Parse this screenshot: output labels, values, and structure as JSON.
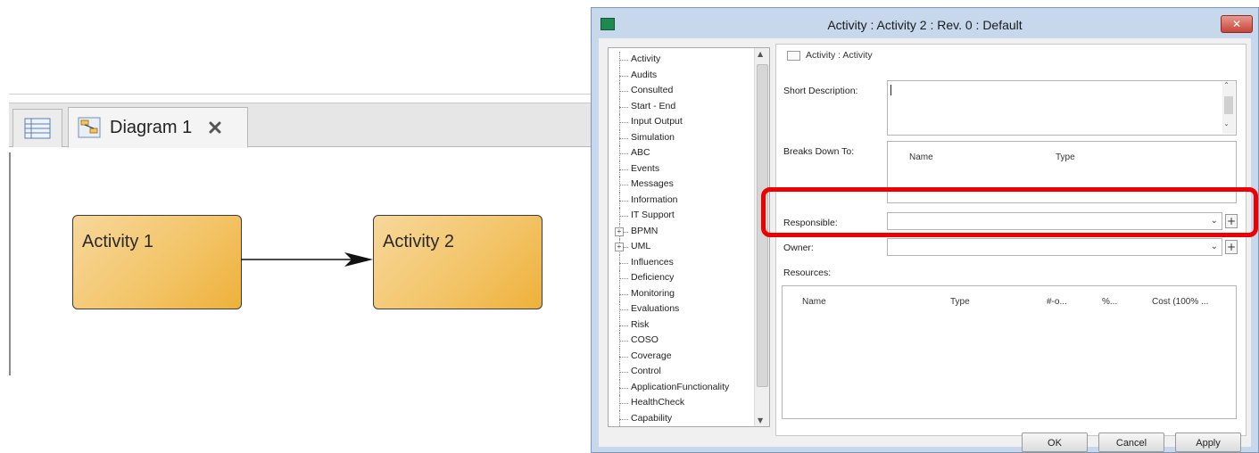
{
  "editor": {
    "tab_label": "Diagram 1",
    "activities": [
      "Activity 1",
      "Activity 2"
    ]
  },
  "dialog": {
    "title": "Activity : Activity 2 : Rev. 0  : Default",
    "close_label": "✕",
    "tree_items": [
      {
        "label": "Activity",
        "expandable": false
      },
      {
        "label": "Audits",
        "expandable": false
      },
      {
        "label": "Consulted",
        "expandable": false
      },
      {
        "label": "Start - End",
        "expandable": false
      },
      {
        "label": "Input Output",
        "expandable": false
      },
      {
        "label": "Simulation",
        "expandable": false
      },
      {
        "label": "ABC",
        "expandable": false
      },
      {
        "label": "Events",
        "expandable": false
      },
      {
        "label": "Messages",
        "expandable": false
      },
      {
        "label": "Information",
        "expandable": false
      },
      {
        "label": "IT Support",
        "expandable": false
      },
      {
        "label": "BPMN",
        "expandable": true
      },
      {
        "label": "UML",
        "expandable": true
      },
      {
        "label": "Influences",
        "expandable": false
      },
      {
        "label": "Deficiency",
        "expandable": false
      },
      {
        "label": "Monitoring",
        "expandable": false
      },
      {
        "label": "Evaluations",
        "expandable": false
      },
      {
        "label": "Risk",
        "expandable": false
      },
      {
        "label": "COSO",
        "expandable": false
      },
      {
        "label": "Coverage",
        "expandable": false
      },
      {
        "label": "Control",
        "expandable": false
      },
      {
        "label": "ApplicationFunctionality",
        "expandable": false
      },
      {
        "label": "HealthCheck",
        "expandable": false
      },
      {
        "label": "Capability",
        "expandable": false
      }
    ],
    "form": {
      "crumb": "Activity : Activity",
      "short_description_label": "Short Description:",
      "short_description_value": "",
      "breaks_down_label": "Breaks Down To:",
      "breaks_down_columns": [
        "Name",
        "Type"
      ],
      "responsible_label": "Responsible:",
      "responsible_value": "",
      "owner_label": "Owner:",
      "owner_value": "",
      "resources_label": "Resources:",
      "resources_columns": [
        "Name",
        "Type",
        "#-o...",
        "%...",
        "Cost (100% ..."
      ]
    },
    "buttons": {
      "ok": "OK",
      "cancel": "Cancel",
      "apply": "Apply"
    }
  },
  "colors": {
    "highlight": "#ee0000",
    "activity_fill": "#f3c56a",
    "dialog_frame": "#c7d8ec"
  }
}
